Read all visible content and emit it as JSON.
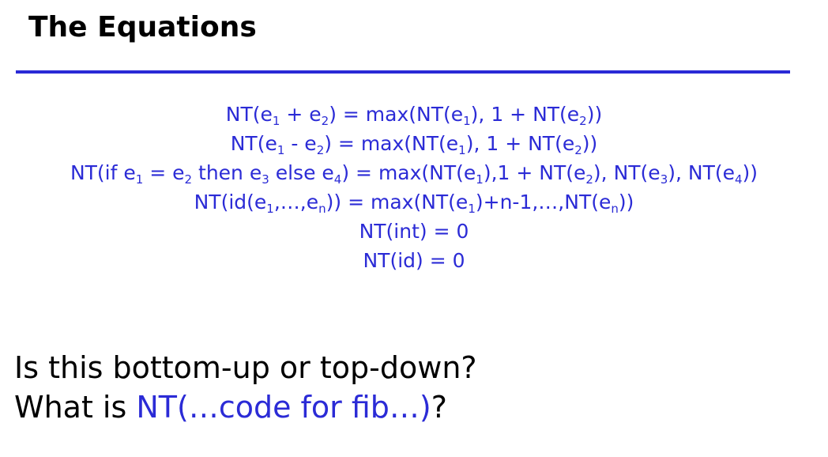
{
  "title": "The Equations",
  "accent_color": "#2a2ad6",
  "equations": {
    "eq1": {
      "a": "NT(e",
      "s1": "1",
      "b": " + e",
      "s2": "2",
      "c": ") = max(NT(e",
      "s3": "1",
      "d": "), 1 + NT(e",
      "s4": "2",
      "e": "))"
    },
    "eq2": {
      "a": "NT(e",
      "s1": "1",
      "b": " - e",
      "s2": "2",
      "c": ") = max(NT(e",
      "s3": "1",
      "d": "), 1 + NT(e",
      "s4": "2",
      "e": "))"
    },
    "eq3": {
      "a": "NT(if e",
      "s1": "1",
      "b": " = e",
      "s2": "2",
      "c": " then e",
      "s3": "3",
      "d": " else e",
      "s4": "4",
      "e": ") = max(NT(e",
      "s5": "1",
      "f": "),1 + NT(e",
      "s6": "2",
      "g": "), NT(e",
      "s7": "3",
      "h": "), NT(e",
      "s8": "4",
      "i": "))"
    },
    "eq4": {
      "a": "NT(id(e",
      "s1": "1",
      "b": ",…,e",
      "s2": "n",
      "c": ")) = max(NT(e",
      "s3": "1",
      "d": ")+n-1,…,NT(e",
      "s4": "n",
      "e": "))"
    },
    "eq5": "NT(int) = 0",
    "eq6": "NT(id) = 0"
  },
  "questions": {
    "q1": "Is this bottom-up or top-down?",
    "q2_prefix": "What is ",
    "q2_highlight": "NT(…code for fib…)",
    "q2_suffix": "?"
  }
}
